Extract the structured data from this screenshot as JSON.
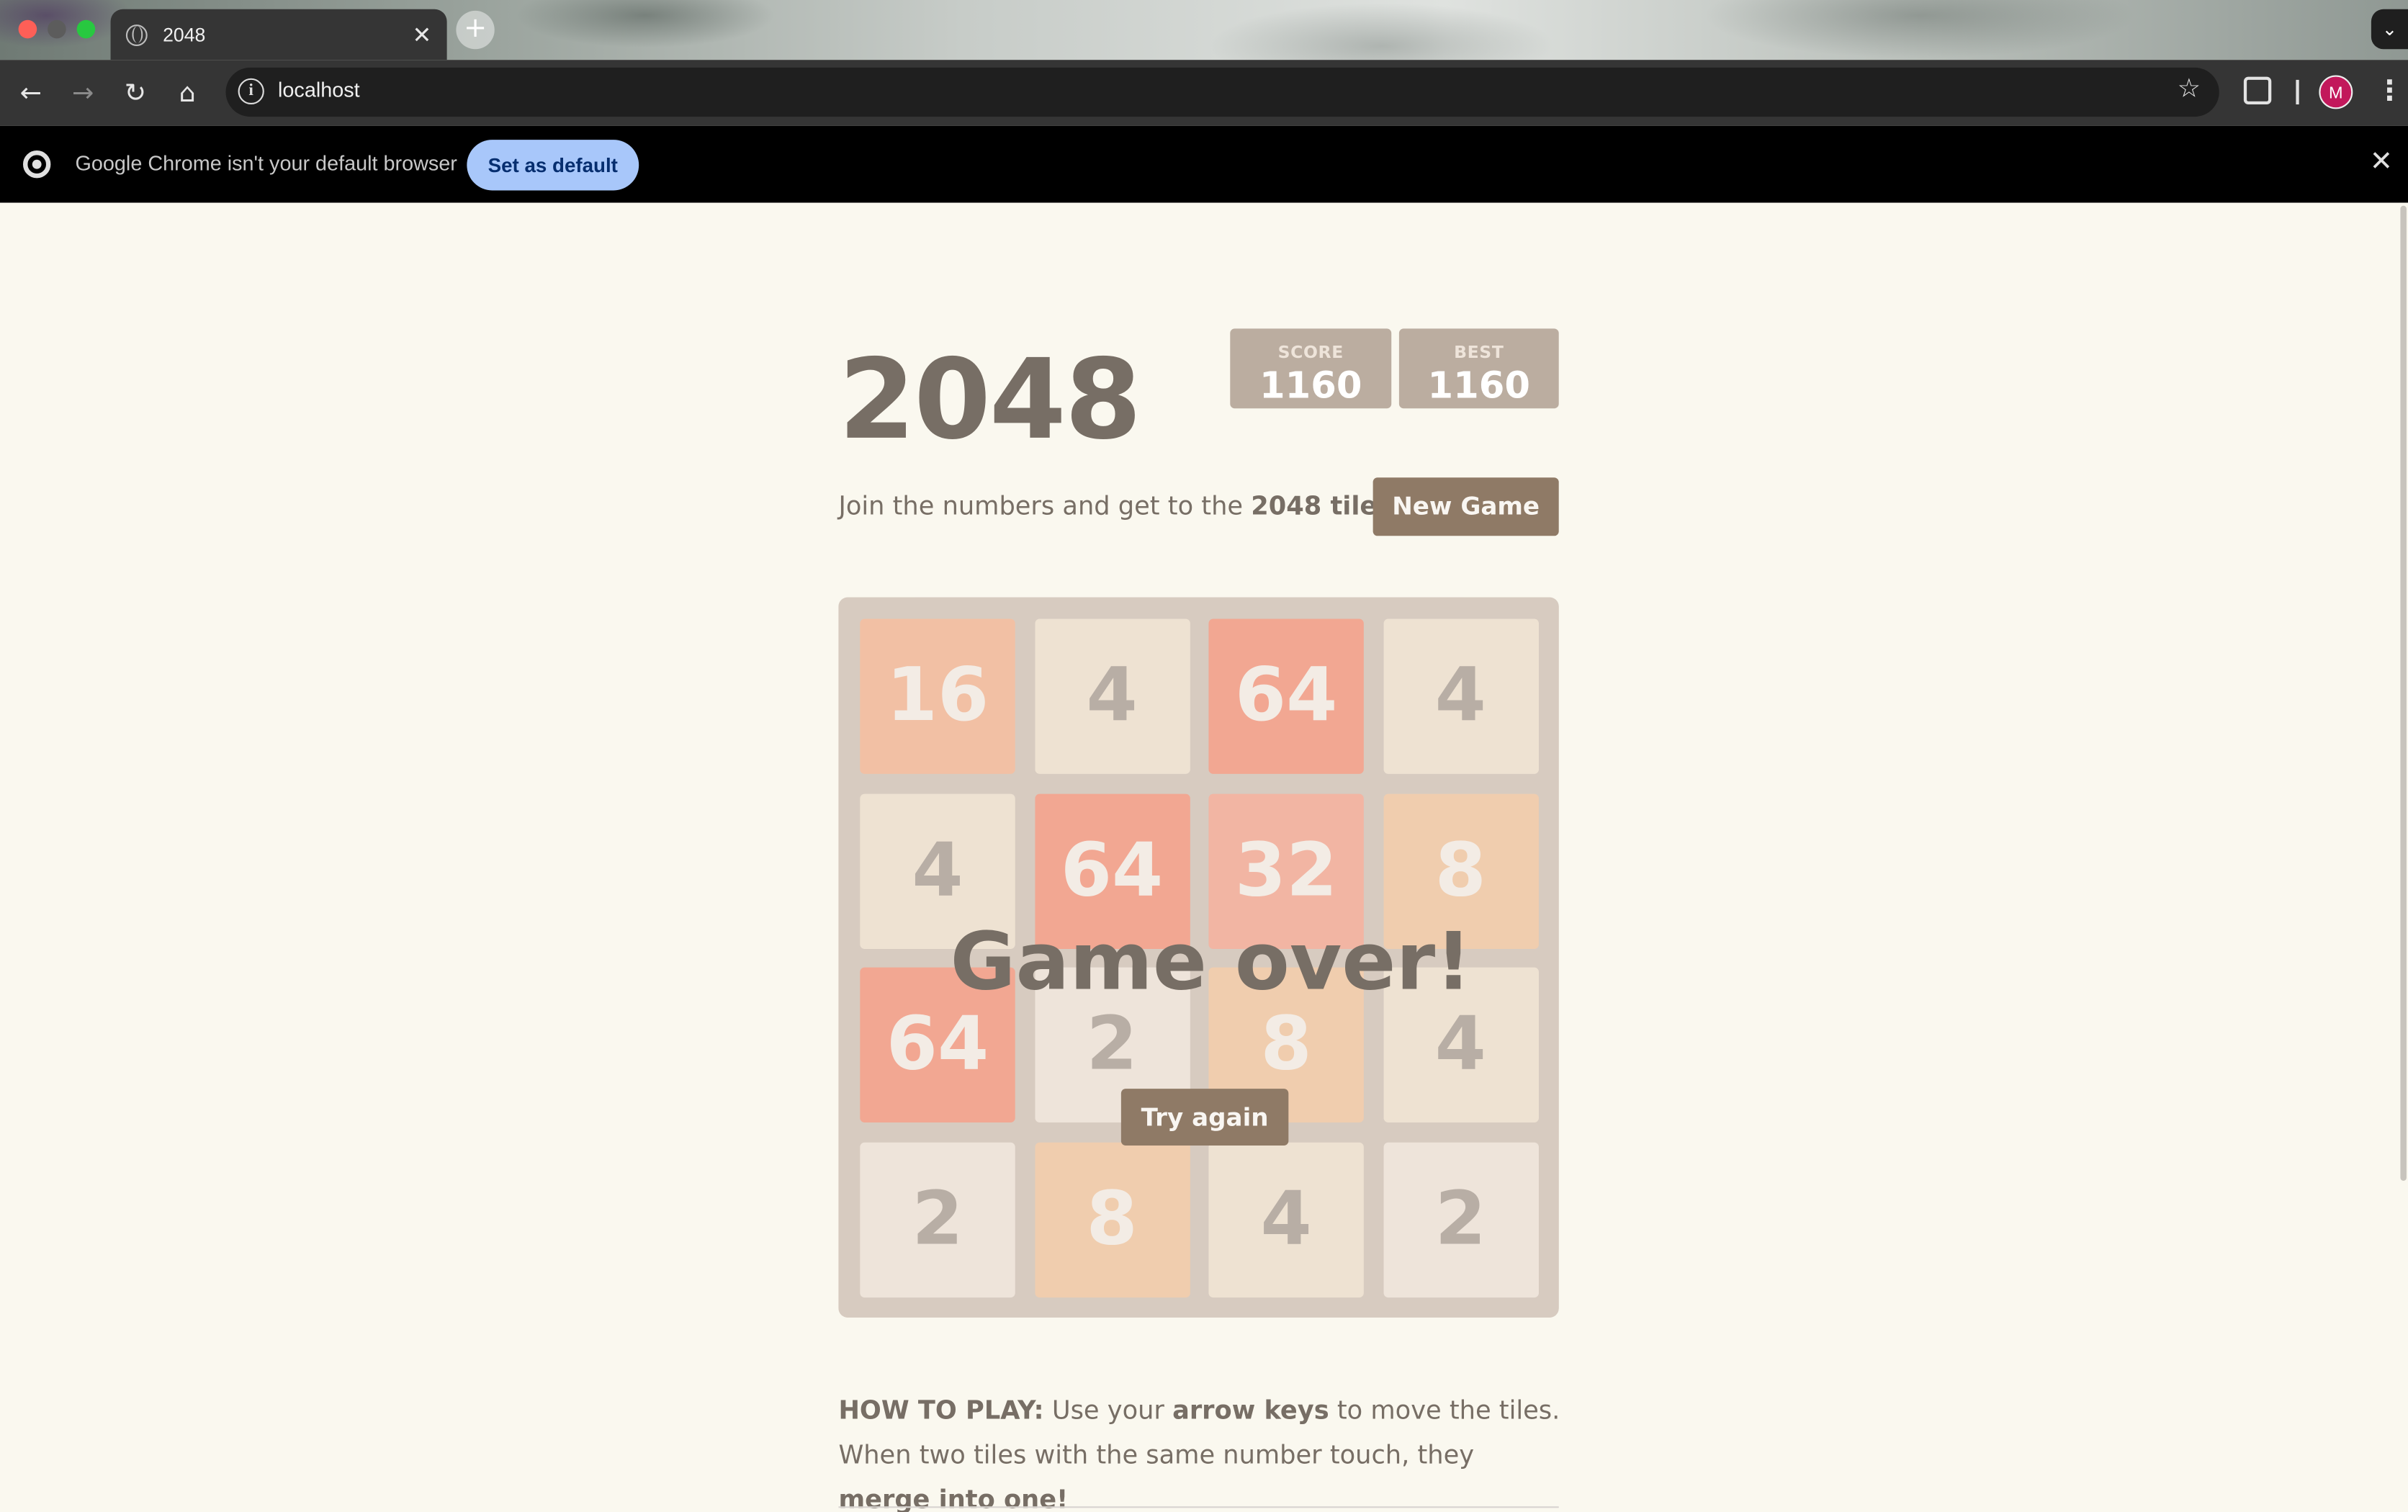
{
  "browser": {
    "tab_title": "2048",
    "tab_close": "✕",
    "new_tab": "+",
    "url": "localhost",
    "avatar_letter": "M",
    "infobar_message": "Google Chrome isn't your default browser",
    "infobar_button": "Set as default",
    "infobar_close": "✕"
  },
  "game": {
    "title": "2048",
    "score_label": "SCORE",
    "score_value": "1160",
    "best_label": "BEST",
    "best_value": "1160",
    "intro_prefix": "Join the numbers and get to the ",
    "intro_bold": "2048 tile!",
    "new_game_label": "New Game",
    "game_over_text": "Game over!",
    "try_again_label": "Try again",
    "grid": [
      [
        16,
        4,
        64,
        4
      ],
      [
        4,
        64,
        32,
        8
      ],
      [
        64,
        2,
        8,
        4
      ],
      [
        2,
        8,
        4,
        2
      ]
    ],
    "tile_colors": {
      "2": {
        "bg": "#eee4da",
        "fg": "#776e65"
      },
      "4": {
        "bg": "#ede0c8",
        "fg": "#776e65"
      },
      "8": {
        "bg": "#f2b179",
        "fg": "#f9f6f2"
      },
      "16": {
        "bg": "#f59563",
        "fg": "#f9f6f2"
      },
      "32": {
        "bg": "#f67c5f",
        "fg": "#f9f6f2"
      },
      "64": {
        "bg": "#f65e3b",
        "fg": "#f9f6f2"
      }
    }
  },
  "howto": {
    "label": "HOW TO PLAY:",
    "part1": " Use your ",
    "bold1": "arrow keys",
    "part2": " to move the tiles. When two tiles with the same number touch, they ",
    "bold2": "merge into one!"
  }
}
